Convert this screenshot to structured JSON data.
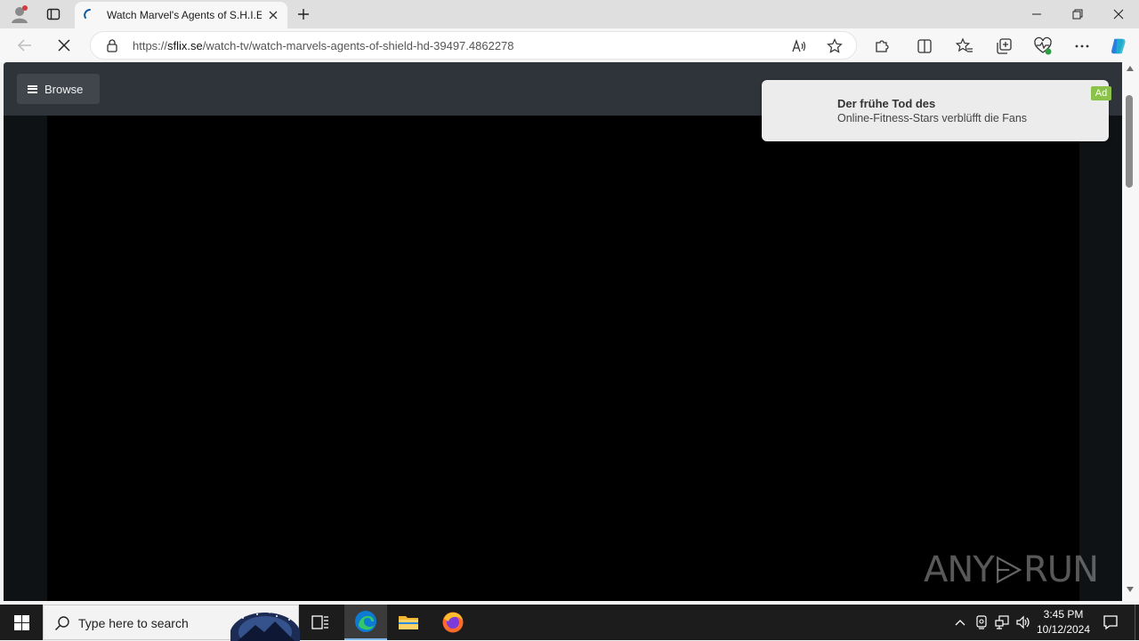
{
  "browser": {
    "tab": {
      "title": "Watch Marvel's Agents of S.H.I.E"
    },
    "url": {
      "scheme": "https://",
      "host": "sflix.se",
      "path": "/watch-tv/watch-marvels-agents-of-shield-hd-39497.4862278"
    }
  },
  "site": {
    "browse_label": "Browse"
  },
  "ad": {
    "title": "Der frühe Tod des",
    "body": "Online-Fitness-Stars verblüfft die Fans",
    "badge": "Ad"
  },
  "watermark": {
    "left": "ANY",
    "right": "RUN"
  },
  "taskbar": {
    "search_placeholder": "Type here to search",
    "time": "3:45 PM",
    "date": "10/12/2024"
  },
  "colors": {
    "header_bg": "#2f343b",
    "player_bg": "#000000",
    "ad_badge": "#8bc34a",
    "edge_accent": "#0078d4"
  }
}
